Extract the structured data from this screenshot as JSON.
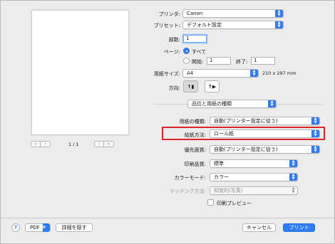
{
  "printer": {
    "label": "プリンタ:",
    "value": "Canon"
  },
  "preset": {
    "label": "プリセット:",
    "value": "デフォルト設定"
  },
  "copies": {
    "label": "部数:",
    "value": "1"
  },
  "pages": {
    "label": "ページ:",
    "all_label": "すべて",
    "from_label": "開始:",
    "from_value": "1",
    "to_label": "終了:",
    "to_value": "1"
  },
  "paper_size": {
    "label": "用紙サイズ:",
    "value": "A4",
    "dimensions": "210 x 297 mm"
  },
  "orientation": {
    "label": "方向:"
  },
  "section_menu": {
    "value": "品位と用紙の種類"
  },
  "media_type": {
    "label": "用紙の種類:",
    "value": "自動(プリンター設定に従う)"
  },
  "paper_source": {
    "label": "給紙方法:",
    "value": "ロール紙"
  },
  "paper_priority": {
    "label": "優先面質:",
    "value": "自動(プリンター設定に従う)"
  },
  "print_quality": {
    "label": "印刷品質:",
    "value": "標準"
  },
  "color_mode": {
    "label": "カラーモード:",
    "value": "カラー"
  },
  "matching": {
    "label": "マッチング方法:",
    "value": "知覚的(写真)"
  },
  "print_preview": {
    "label": "印刷プレビュー"
  },
  "preview": {
    "page_counter": "1 / 1"
  },
  "footer": {
    "help": "?",
    "pdf": "PDF",
    "hide_details": "詳細を隠す",
    "cancel": "キャンセル",
    "print": "プリント"
  },
  "colors": {
    "accent": "#2f7cf6",
    "highlight": "#d9262a"
  }
}
